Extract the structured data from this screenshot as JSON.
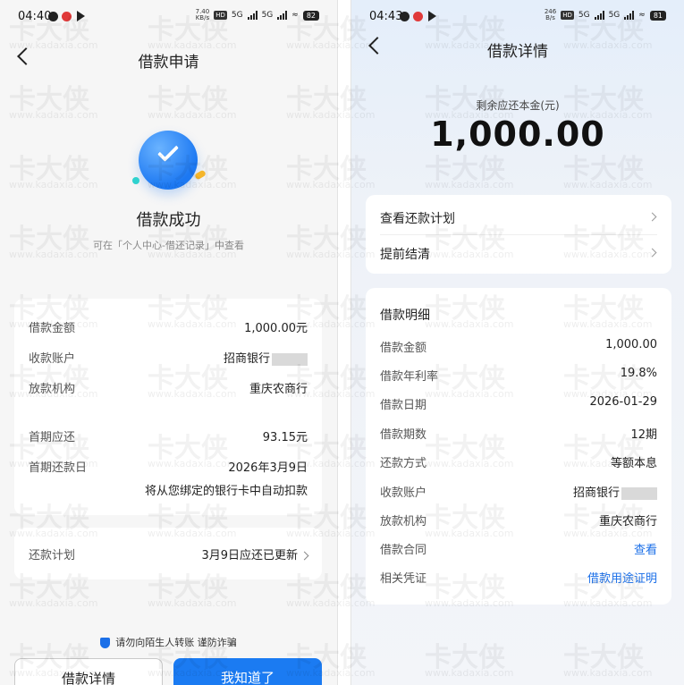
{
  "left": {
    "status": {
      "time": "04:40",
      "speed": "7.40",
      "speed_unit": "KB/s",
      "sim1": "5G",
      "sim2": "5G",
      "battery": "82"
    },
    "nav_title": "借款申请",
    "success_title": "借款成功",
    "success_sub": "可在「个人中心-借还记录」中查看",
    "details": [
      {
        "key": "借款金额",
        "value": "1,000.00元"
      },
      {
        "key": "收款账户",
        "value": "招商银行"
      },
      {
        "key": "放款机构",
        "value": "重庆农商行"
      },
      {
        "key": "首期应还",
        "value": "93.15元"
      },
      {
        "key": "首期还款日",
        "value": "2026年3月9日"
      }
    ],
    "auto_debit_note": "将从您绑定的银行卡中自动扣款",
    "plan": {
      "key": "还款计划",
      "value": "3月9日应还已更新"
    },
    "warning": "请勿向陌生人转账 谨防诈骗",
    "btn_detail": "借款详情",
    "btn_ok": "我知道了"
  },
  "right": {
    "status": {
      "time": "04:43",
      "speed": "246",
      "speed_unit": "B/s",
      "sim1": "5G",
      "sim2": "5G",
      "battery": "81"
    },
    "nav_title": "借款详情",
    "remaining_label": "剩余应还本金(元)",
    "remaining_amount": "1,000.00",
    "links": [
      "查看还款计划",
      "提前结清"
    ],
    "section_title": "借款明细",
    "details": [
      {
        "key": "借款金额",
        "value": "1,000.00"
      },
      {
        "key": "借款年利率",
        "value": "19.8%"
      },
      {
        "key": "借款日期",
        "value": "2026-01-29"
      },
      {
        "key": "借款期数",
        "value": "12期"
      },
      {
        "key": "还款方式",
        "value": "等额本息"
      },
      {
        "key": "收款账户",
        "value": "招商银行"
      },
      {
        "key": "放款机构",
        "value": "重庆农商行"
      },
      {
        "key": "借款合同",
        "value": "查看"
      },
      {
        "key": "相关凭证",
        "value": "借款用途证明"
      }
    ]
  },
  "watermark": {
    "text": "卡大侠",
    "site": "www.kadaxia.com"
  },
  "colors": {
    "accent": "#1b7bf2",
    "link": "#1b6fe8"
  }
}
